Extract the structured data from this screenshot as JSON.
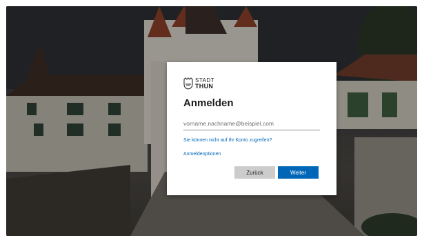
{
  "background": {
    "description_icon": "castle-photo-background"
  },
  "dialog": {
    "logo": {
      "line1": "STADT",
      "line2": "THUN",
      "icon": "shield-crest-icon"
    },
    "title": "Anmelden",
    "email_placeholder": "vorname.nachname@beispiel.com",
    "email_value": "",
    "cant_access_link": "Sie können nicht auf Ihr Konto zugreifen?",
    "signin_options_link": "Anmeldeoptionen",
    "back_button": "Zurück",
    "next_button": "Weiter"
  },
  "colors": {
    "accent": "#0067b8",
    "secondary_button": "#cccccc",
    "text": "#1b1b1b"
  }
}
